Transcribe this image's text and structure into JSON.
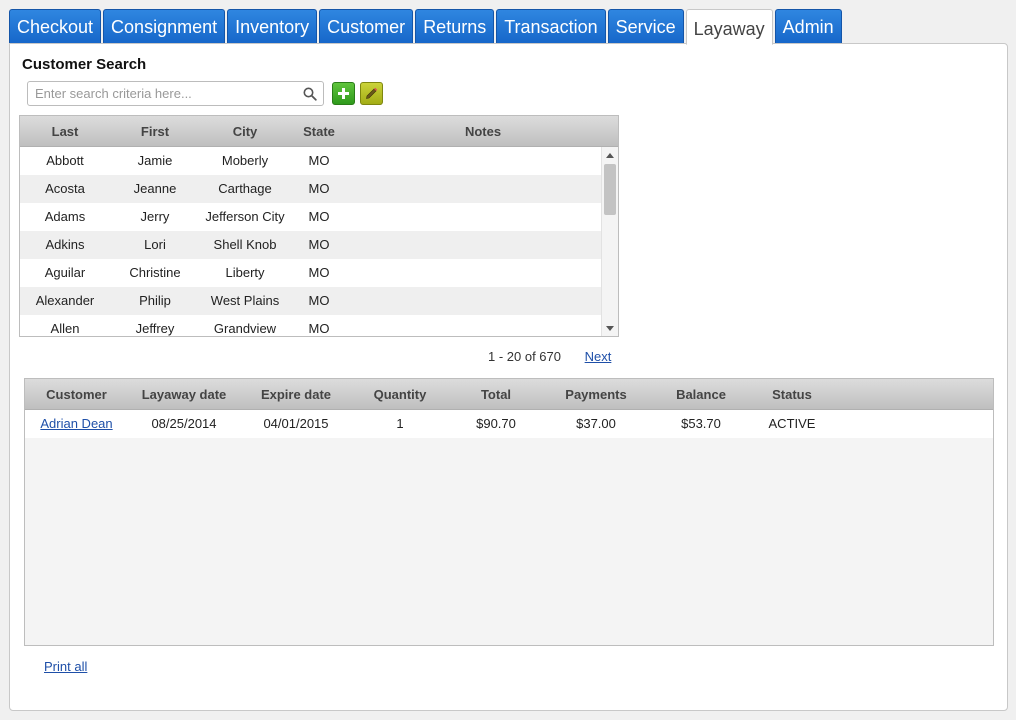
{
  "tabs": [
    {
      "label": "Checkout"
    },
    {
      "label": "Consignment"
    },
    {
      "label": "Inventory"
    },
    {
      "label": "Customer"
    },
    {
      "label": "Returns"
    },
    {
      "label": "Transaction"
    },
    {
      "label": "Service"
    },
    {
      "label": "Layaway",
      "active": true
    },
    {
      "label": "Admin"
    }
  ],
  "customer_search": {
    "title": "Customer Search",
    "placeholder": "Enter search criteria here...",
    "search_icon": "magnifier-icon",
    "add_icon": "plus-icon",
    "edit_icon": "pencil-icon"
  },
  "customer_grid": {
    "columns": {
      "last": "Last",
      "first": "First",
      "city": "City",
      "state": "State",
      "notes": "Notes"
    },
    "rows": [
      {
        "last": "Abbott",
        "first": "Jamie",
        "city": "Moberly",
        "state": "MO",
        "notes": ""
      },
      {
        "last": "Acosta",
        "first": "Jeanne",
        "city": "Carthage",
        "state": "MO",
        "notes": ""
      },
      {
        "last": "Adams",
        "first": "Jerry",
        "city": "Jefferson City",
        "state": "MO",
        "notes": ""
      },
      {
        "last": "Adkins",
        "first": "Lori",
        "city": "Shell Knob",
        "state": "MO",
        "notes": ""
      },
      {
        "last": "Aguilar",
        "first": "Christine",
        "city": "Liberty",
        "state": "MO",
        "notes": ""
      },
      {
        "last": "Alexander",
        "first": "Philip",
        "city": "West Plains",
        "state": "MO",
        "notes": ""
      },
      {
        "last": "Allen",
        "first": "Jeffrey",
        "city": "Grandview",
        "state": "MO",
        "notes": ""
      }
    ]
  },
  "pager": {
    "range": "1 - 20 of 670",
    "next": "Next"
  },
  "layaway_grid": {
    "columns": {
      "customer": "Customer",
      "layaway_date": "Layaway date",
      "expire_date": "Expire date",
      "quantity": "Quantity",
      "total": "Total",
      "payments": "Payments",
      "balance": "Balance",
      "status": "Status"
    },
    "rows": [
      {
        "customer": "Adrian Dean",
        "layaway_date": "08/25/2014",
        "expire_date": "04/01/2015",
        "quantity": "1",
        "total": "$90.70",
        "payments": "$37.00",
        "balance": "$53.70",
        "status": "ACTIVE"
      }
    ]
  },
  "footer": {
    "print_all": "Print all"
  }
}
